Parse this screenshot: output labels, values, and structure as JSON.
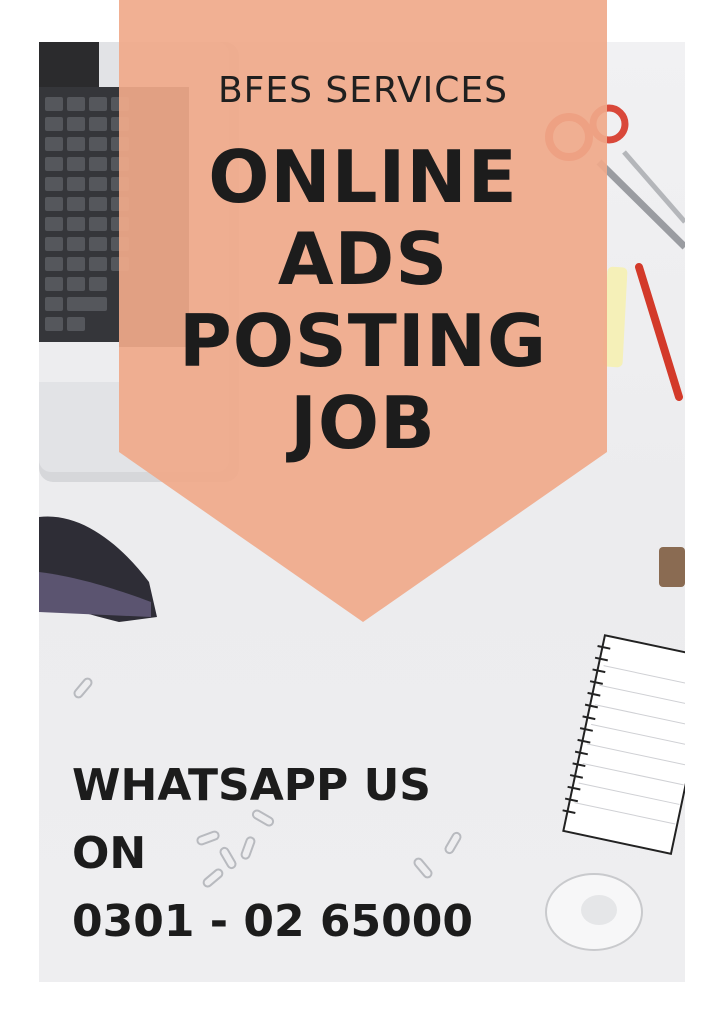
{
  "poster": {
    "brand": "BFES SERVICES",
    "headline": [
      "ONLINE",
      "ADS",
      "POSTING",
      "JOB"
    ],
    "contact": [
      "WHATSAPP US",
      "ON",
      "0301 - 02 65000"
    ]
  },
  "colors": {
    "banner": "#f0a98a",
    "text": "#1c1c1c",
    "background": "#ededef"
  }
}
